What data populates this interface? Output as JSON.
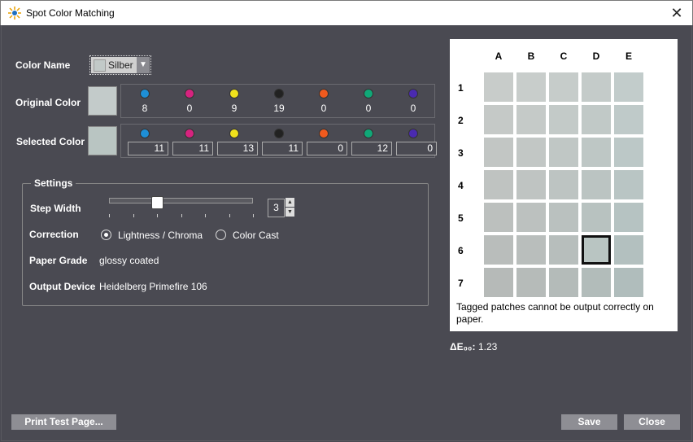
{
  "window": {
    "title": "Spot Color Matching",
    "close_symbol": "✕"
  },
  "labels": {
    "color_name": "Color Name",
    "original_color": "Original Color",
    "selected_color": "Selected Color"
  },
  "color_name": {
    "value": "Silber",
    "swatch": "#c2c9c8"
  },
  "swatches": {
    "original": "#c3cbca",
    "selected": "#b9c5c2"
  },
  "inks": [
    {
      "name": "cyan-ink",
      "color": "#1e8fd6"
    },
    {
      "name": "magenta-ink",
      "color": "#d6237f"
    },
    {
      "name": "yellow-ink",
      "color": "#f0e21c"
    },
    {
      "name": "black-ink",
      "color": "#222222"
    },
    {
      "name": "orange-ink",
      "color": "#f05a1e"
    },
    {
      "name": "green-ink",
      "color": "#10a878"
    },
    {
      "name": "violet-ink",
      "color": "#4a2ab0"
    }
  ],
  "original_values": [
    "8",
    "0",
    "9",
    "19",
    "0",
    "0",
    "0"
  ],
  "selected_values": [
    "11",
    "11",
    "13",
    "11",
    "0",
    "12",
    "0"
  ],
  "settings": {
    "legend": "Settings",
    "step_width_label": "Step Width",
    "step_width_value": "3",
    "slider_value": 3,
    "correction_label": "Correction",
    "correction_options": [
      "Lightness / Chroma",
      "Color Cast"
    ],
    "correction_selected": 0,
    "paper_grade_label": "Paper Grade",
    "paper_grade_value": "glossy coated",
    "output_device_label": "Output Device",
    "output_device_value": "Heidelberg Primefire 106"
  },
  "grid": {
    "columns": [
      "A",
      "B",
      "C",
      "D",
      "E"
    ],
    "rows": [
      "1",
      "2",
      "3",
      "4",
      "5",
      "6",
      "7"
    ],
    "selected": {
      "row": 5,
      "col": 3
    },
    "colors": [
      [
        "#c8ccca",
        "#c8cdcb",
        "#c6ccca",
        "#c4cbc9",
        "#c2cccb"
      ],
      [
        "#c5c9c7",
        "#c5cac8",
        "#c3cac8",
        "#c1c9c7",
        "#bfcac9"
      ],
      [
        "#c2c6c4",
        "#c2c7c5",
        "#c0c7c5",
        "#bec7c5",
        "#bcc8c7"
      ],
      [
        "#bfc3c1",
        "#bfc4c2",
        "#bdc4c2",
        "#bbc4c2",
        "#b9c5c4"
      ],
      [
        "#bcc0be",
        "#bcc1bf",
        "#bac1bf",
        "#b8c2c0",
        "#b6c3c2"
      ],
      [
        "#b9bdbb",
        "#b9bebc",
        "#b7bebc",
        "#b9c5c2",
        "#b3c0bf"
      ],
      [
        "#b6bab8",
        "#b6bbb9",
        "#b4bbb9",
        "#b2bcba",
        "#b0bdbc"
      ]
    ],
    "note": "Tagged patches cannot be output correctly on paper."
  },
  "delta": {
    "label": "ΔE₀₀:",
    "value": "1.23"
  },
  "buttons": {
    "print": "Print Test Page...",
    "save": "Save",
    "close": "Close"
  }
}
